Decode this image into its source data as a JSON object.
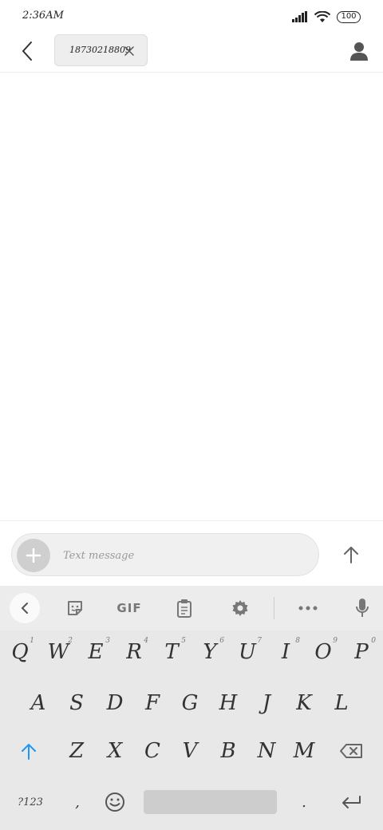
{
  "status_bar": {
    "time": "2:36AM",
    "battery": "100"
  },
  "header": {
    "recipient": "18730218809"
  },
  "compose": {
    "placeholder": "Text message"
  },
  "keyboard": {
    "toolbar": {
      "gif_label": "GIF"
    },
    "row1": [
      {
        "key": "Q",
        "num": "1"
      },
      {
        "key": "W",
        "num": "2"
      },
      {
        "key": "E",
        "num": "3"
      },
      {
        "key": "R",
        "num": "4"
      },
      {
        "key": "T",
        "num": "5"
      },
      {
        "key": "Y",
        "num": "6"
      },
      {
        "key": "U",
        "num": "7"
      },
      {
        "key": "I",
        "num": "8"
      },
      {
        "key": "O",
        "num": "9"
      },
      {
        "key": "P",
        "num": "0"
      }
    ],
    "row2": [
      "A",
      "S",
      "D",
      "F",
      "G",
      "H",
      "J",
      "K",
      "L"
    ],
    "row3": [
      "Z",
      "X",
      "C",
      "V",
      "B",
      "N",
      "M"
    ],
    "symbols_label": "?123",
    "comma": ",",
    "period": "."
  },
  "colors": {
    "shift_accent": "#2196f3",
    "keyboard_bg": "#e8e8e8",
    "icon_gray": "#777777"
  }
}
